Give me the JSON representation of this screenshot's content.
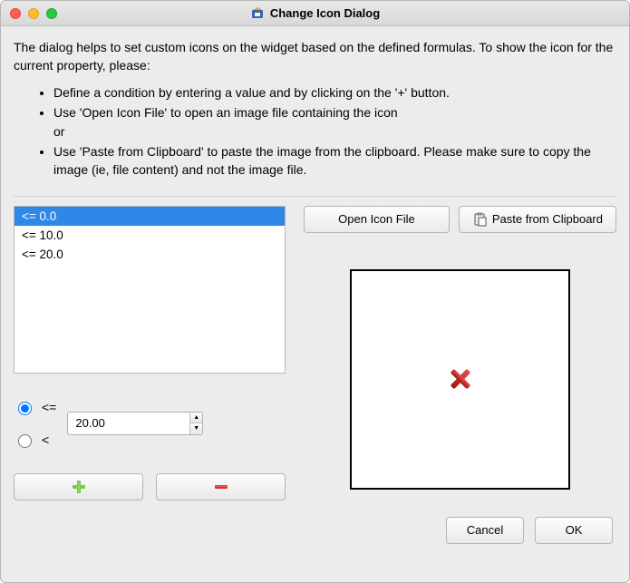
{
  "window": {
    "title": "Change Icon Dialog"
  },
  "help": {
    "intro": "The dialog helps to set custom icons on the widget based on the defined formulas. To show the icon for the current property, please:",
    "bullet1": "Define a condition by entering a value and by clicking on the '+' button.",
    "bullet2": "Use 'Open Icon File' to open an image file containing the icon",
    "bullet2b": "or",
    "bullet3": "Use 'Paste from Clipboard' to paste the image from the clipboard. Please make sure to copy the image (ie, file content) and not the image file."
  },
  "list": {
    "items": [
      {
        "label": "<= 0.0",
        "selected": true
      },
      {
        "label": "<= 10.0",
        "selected": false
      },
      {
        "label": "<= 20.0",
        "selected": false
      }
    ]
  },
  "condition": {
    "op_lte": "<=",
    "op_lt": "<",
    "selected_op": "lte",
    "value": "20.00"
  },
  "buttons": {
    "open_icon": "Open Icon File",
    "paste_clip": "Paste from Clipboard",
    "cancel": "Cancel",
    "ok": "OK"
  },
  "icons": {
    "plus_color": "#5fb32a",
    "minus_color": "#d9302c",
    "preview_x_color": "#c21e1a"
  }
}
